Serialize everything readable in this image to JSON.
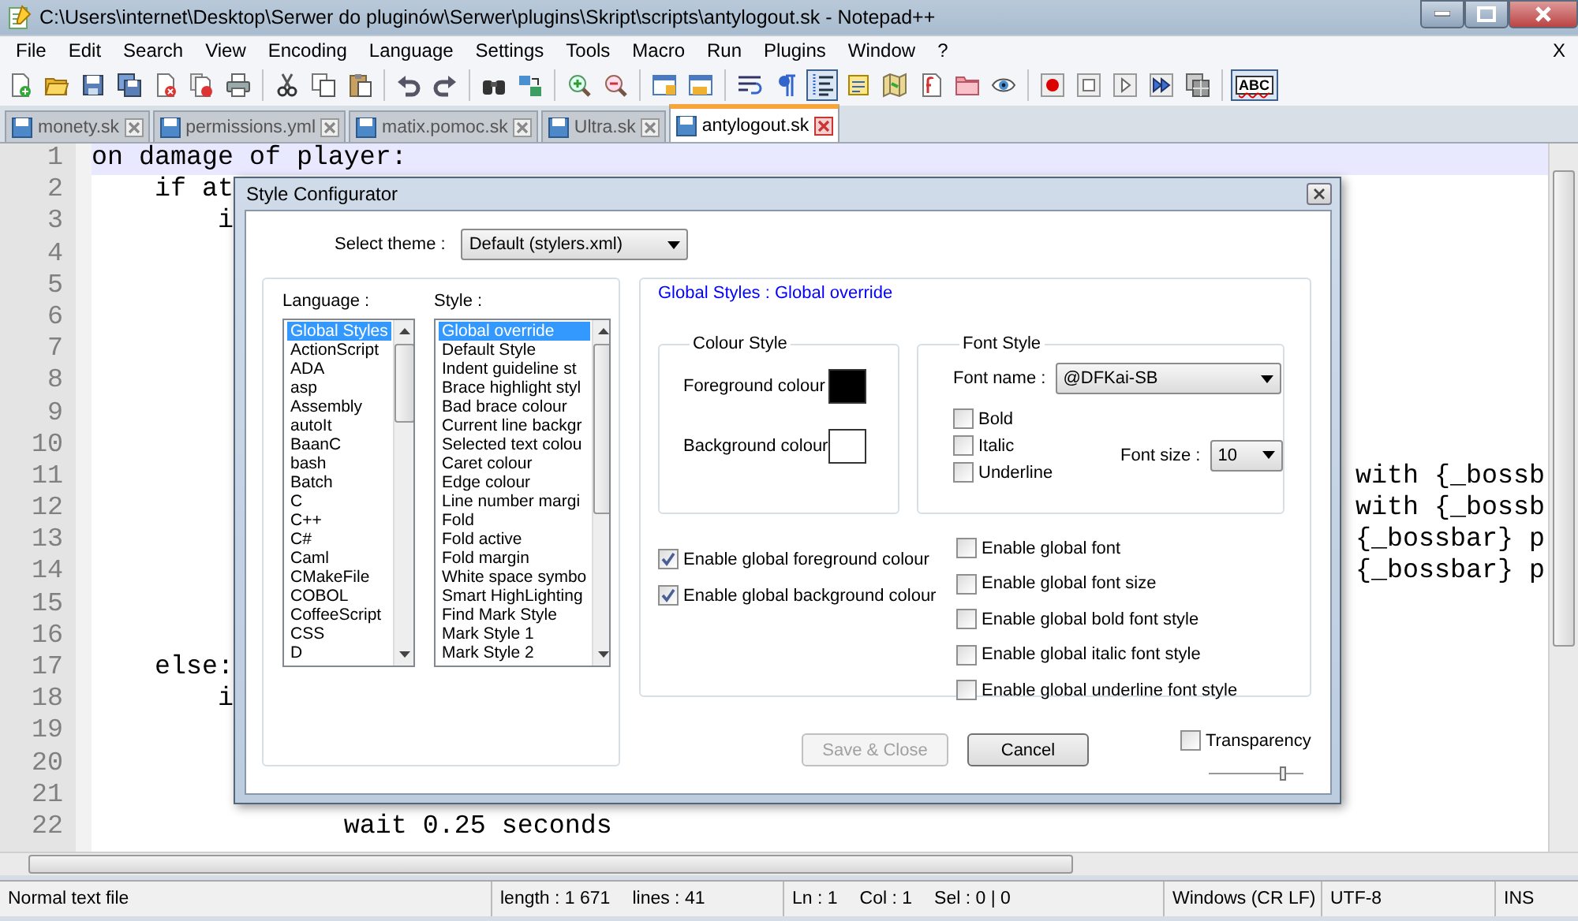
{
  "window": {
    "title": "C:\\Users\\internet\\Desktop\\Serwer do pluginów\\Serwer\\plugins\\Skript\\scripts\\antylogout.sk - Notepad++"
  },
  "menu": [
    "File",
    "Edit",
    "Search",
    "View",
    "Encoding",
    "Language",
    "Settings",
    "Tools",
    "Macro",
    "Run",
    "Plugins",
    "Window",
    "?"
  ],
  "menu_close": "X",
  "toolbar": [
    {
      "buttons": [
        {
          "kind": "new",
          "pressed": false
        },
        {
          "kind": "open",
          "pressed": false
        },
        {
          "kind": "save",
          "pressed": false
        },
        {
          "kind": "saveall",
          "pressed": false
        },
        {
          "kind": "close",
          "pressed": false
        },
        {
          "kind": "closeall",
          "pressed": false
        },
        {
          "kind": "print",
          "pressed": false
        }
      ]
    },
    {
      "buttons": [
        {
          "kind": "cut",
          "pressed": false
        },
        {
          "kind": "copy",
          "pressed": false
        },
        {
          "kind": "paste",
          "pressed": false
        }
      ]
    },
    {
      "buttons": [
        {
          "kind": "undo",
          "pressed": false
        },
        {
          "kind": "redo",
          "pressed": false
        }
      ]
    },
    {
      "buttons": [
        {
          "kind": "find",
          "pressed": false
        },
        {
          "kind": "replace",
          "pressed": false
        }
      ]
    },
    {
      "buttons": [
        {
          "kind": "zoomin",
          "pressed": false
        },
        {
          "kind": "zoomout",
          "pressed": false
        }
      ]
    },
    {
      "buttons": [
        {
          "kind": "syncv",
          "pressed": false
        },
        {
          "kind": "synch",
          "pressed": false
        }
      ]
    },
    {
      "buttons": [
        {
          "kind": "wrap",
          "pressed": false
        },
        {
          "kind": "allchars",
          "pressed": false
        },
        {
          "kind": "indent",
          "pressed": true
        },
        {
          "kind": "udl",
          "pressed": false
        },
        {
          "kind": "docmap",
          "pressed": false
        },
        {
          "kind": "funclist",
          "pressed": false
        },
        {
          "kind": "folder",
          "pressed": false
        },
        {
          "kind": "monitor",
          "pressed": false
        }
      ]
    },
    {
      "buttons": [
        {
          "kind": "record",
          "pressed": false
        },
        {
          "kind": "stop",
          "pressed": false
        },
        {
          "kind": "play",
          "pressed": false
        },
        {
          "kind": "playmulti",
          "pressed": false
        },
        {
          "kind": "savemacro",
          "pressed": false
        }
      ]
    },
    {
      "buttons": [
        {
          "kind": "spell",
          "pressed": true,
          "label": "ABC"
        }
      ]
    }
  ],
  "tabs": [
    {
      "label": "monety.sk",
      "selected": false
    },
    {
      "label": "permissions.yml",
      "selected": false
    },
    {
      "label": "matix.pomoc.sk",
      "selected": false
    },
    {
      "label": "Ultra.sk",
      "selected": false
    },
    {
      "label": "antylogout.sk",
      "selected": true
    }
  ],
  "editor": {
    "lines": [
      {
        "number": "1",
        "text": "on damage of player:",
        "current": true
      },
      {
        "number": "2",
        "text": "    if at",
        "current": false
      },
      {
        "number": "3",
        "text": "        i",
        "current": false
      },
      {
        "number": "4",
        "current": false
      },
      {
        "number": "5",
        "current": false
      },
      {
        "number": "6",
        "current": false
      },
      {
        "number": "7",
        "current": false
      },
      {
        "number": "8",
        "current": false
      },
      {
        "number": "9",
        "current": false
      },
      {
        "number": "10",
        "current": false
      },
      {
        "number": "11",
        "tail": "with {_bossb",
        "current": false
      },
      {
        "number": "12",
        "tail": "with {_bossb",
        "current": false
      },
      {
        "number": "13",
        "tail": "{_bossbar} p",
        "current": false
      },
      {
        "number": "14",
        "tail": "{_bossbar} p",
        "current": false
      },
      {
        "number": "15",
        "current": false
      },
      {
        "number": "16",
        "current": false
      },
      {
        "number": "17",
        "text": "    else:",
        "current": false
      },
      {
        "number": "18",
        "text": "        i",
        "current": false
      },
      {
        "number": "19",
        "current": false
      },
      {
        "number": "20",
        "current": false
      },
      {
        "number": "21",
        "current": false
      },
      {
        "number": "22",
        "text": "                wait 0.25 seconds",
        "current": false
      }
    ]
  },
  "dialog": {
    "title": "Style Configurator",
    "theme_label": "Select theme :",
    "theme": "Default (stylers.xml)",
    "language_label": "Language :",
    "languages": [
      {
        "label": "Global Styles",
        "selected": true
      },
      {
        "label": "ActionScript",
        "selected": false
      },
      {
        "label": "ADA",
        "selected": false
      },
      {
        "label": "asp",
        "selected": false
      },
      {
        "label": "Assembly",
        "selected": false
      },
      {
        "label": "autoIt",
        "selected": false
      },
      {
        "label": "BaanC",
        "selected": false
      },
      {
        "label": "bash",
        "selected": false
      },
      {
        "label": "Batch",
        "selected": false
      },
      {
        "label": "C",
        "selected": false
      },
      {
        "label": "C++",
        "selected": false
      },
      {
        "label": "C#",
        "selected": false
      },
      {
        "label": "Caml",
        "selected": false
      },
      {
        "label": "CMakeFile",
        "selected": false
      },
      {
        "label": "COBOL",
        "selected": false
      },
      {
        "label": "CoffeeScript",
        "selected": false
      },
      {
        "label": "CSS",
        "selected": false
      },
      {
        "label": "D",
        "selected": false
      }
    ],
    "style_label": "Style :",
    "styles": [
      {
        "label": "Global override",
        "selected": true
      },
      {
        "label": "Default Style",
        "selected": false
      },
      {
        "label": "Indent guideline st",
        "selected": false
      },
      {
        "label": "Brace highlight styl",
        "selected": false
      },
      {
        "label": "Bad brace colour",
        "selected": false
      },
      {
        "label": "Current line backgr",
        "selected": false
      },
      {
        "label": "Selected text colou",
        "selected": false
      },
      {
        "label": "Caret colour",
        "selected": false
      },
      {
        "label": "Edge colour",
        "selected": false
      },
      {
        "label": "Line number margi",
        "selected": false
      },
      {
        "label": "Fold",
        "selected": false
      },
      {
        "label": "Fold active",
        "selected": false
      },
      {
        "label": "Fold margin",
        "selected": false
      },
      {
        "label": "White space symbo",
        "selected": false
      },
      {
        "label": "Smart HighLighting",
        "selected": false
      },
      {
        "label": "Find Mark Style",
        "selected": false
      },
      {
        "label": "Mark Style 1",
        "selected": false
      },
      {
        "label": "Mark Style 2",
        "selected": false
      }
    ],
    "heading": "Global Styles : Global override",
    "colour_style": {
      "title": "Colour Style",
      "swatches": [
        {
          "label": "Foreground colour",
          "color": "#000000"
        },
        {
          "label": "Background colour",
          "color": "#ffffff"
        }
      ]
    },
    "font_style": {
      "title": "Font Style",
      "font_name_label": "Font name :",
      "font_name": "@DFKai-SB",
      "options": [
        {
          "label": "Bold",
          "checked": false
        },
        {
          "label": "Italic",
          "checked": false
        },
        {
          "label": "Underline",
          "checked": false
        }
      ],
      "font_size_label": "Font size :",
      "font_size": "10"
    },
    "global_colour_options": [
      {
        "label": "Enable global foreground colour",
        "checked": true
      },
      {
        "label": "Enable global background colour",
        "checked": true
      }
    ],
    "global_font_options": [
      {
        "label": "Enable global font",
        "checked": false
      },
      {
        "label": "Enable global font size",
        "checked": false
      },
      {
        "label": "Enable global bold font style",
        "checked": false
      },
      {
        "label": "Enable global italic font style",
        "checked": false
      },
      {
        "label": "Enable global underline font style",
        "checked": false
      }
    ],
    "buttons": [
      {
        "label": "Save & Close",
        "disabled": true
      },
      {
        "label": "Cancel",
        "disabled": false
      }
    ],
    "transparency": {
      "label": "Transparency",
      "checked": false,
      "level": 0.78
    }
  },
  "status_bar": [
    [
      "Normal text file"
    ],
    [
      "length : 1 671",
      "lines : 41"
    ],
    [
      "Ln : 1",
      "Col : 1",
      "Sel : 0 | 0"
    ],
    [
      "Windows (CR LF)"
    ],
    [
      "UTF-8"
    ],
    [
      "INS"
    ]
  ]
}
